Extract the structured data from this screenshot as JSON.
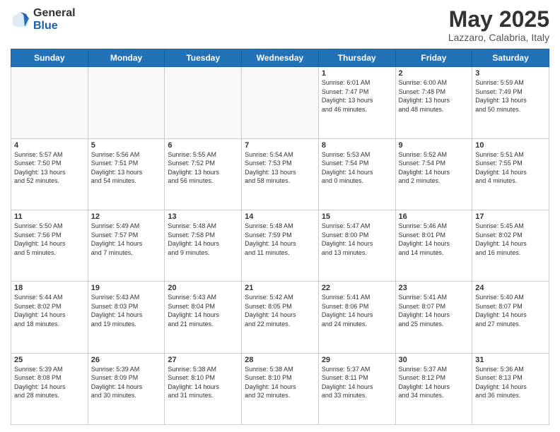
{
  "header": {
    "logo_general": "General",
    "logo_blue": "Blue",
    "month_title": "May 2025",
    "location": "Lazzaro, Calabria, Italy"
  },
  "days_of_week": [
    "Sunday",
    "Monday",
    "Tuesday",
    "Wednesday",
    "Thursday",
    "Friday",
    "Saturday"
  ],
  "weeks": [
    [
      {
        "day": "",
        "info": ""
      },
      {
        "day": "",
        "info": ""
      },
      {
        "day": "",
        "info": ""
      },
      {
        "day": "",
        "info": ""
      },
      {
        "day": "1",
        "info": "Sunrise: 6:01 AM\nSunset: 7:47 PM\nDaylight: 13 hours\nand 46 minutes."
      },
      {
        "day": "2",
        "info": "Sunrise: 6:00 AM\nSunset: 7:48 PM\nDaylight: 13 hours\nand 48 minutes."
      },
      {
        "day": "3",
        "info": "Sunrise: 5:59 AM\nSunset: 7:49 PM\nDaylight: 13 hours\nand 50 minutes."
      }
    ],
    [
      {
        "day": "4",
        "info": "Sunrise: 5:57 AM\nSunset: 7:50 PM\nDaylight: 13 hours\nand 52 minutes."
      },
      {
        "day": "5",
        "info": "Sunrise: 5:56 AM\nSunset: 7:51 PM\nDaylight: 13 hours\nand 54 minutes."
      },
      {
        "day": "6",
        "info": "Sunrise: 5:55 AM\nSunset: 7:52 PM\nDaylight: 13 hours\nand 56 minutes."
      },
      {
        "day": "7",
        "info": "Sunrise: 5:54 AM\nSunset: 7:53 PM\nDaylight: 13 hours\nand 58 minutes."
      },
      {
        "day": "8",
        "info": "Sunrise: 5:53 AM\nSunset: 7:54 PM\nDaylight: 14 hours\nand 0 minutes."
      },
      {
        "day": "9",
        "info": "Sunrise: 5:52 AM\nSunset: 7:54 PM\nDaylight: 14 hours\nand 2 minutes."
      },
      {
        "day": "10",
        "info": "Sunrise: 5:51 AM\nSunset: 7:55 PM\nDaylight: 14 hours\nand 4 minutes."
      }
    ],
    [
      {
        "day": "11",
        "info": "Sunrise: 5:50 AM\nSunset: 7:56 PM\nDaylight: 14 hours\nand 5 minutes."
      },
      {
        "day": "12",
        "info": "Sunrise: 5:49 AM\nSunset: 7:57 PM\nDaylight: 14 hours\nand 7 minutes."
      },
      {
        "day": "13",
        "info": "Sunrise: 5:48 AM\nSunset: 7:58 PM\nDaylight: 14 hours\nand 9 minutes."
      },
      {
        "day": "14",
        "info": "Sunrise: 5:48 AM\nSunset: 7:59 PM\nDaylight: 14 hours\nand 11 minutes."
      },
      {
        "day": "15",
        "info": "Sunrise: 5:47 AM\nSunset: 8:00 PM\nDaylight: 14 hours\nand 13 minutes."
      },
      {
        "day": "16",
        "info": "Sunrise: 5:46 AM\nSunset: 8:01 PM\nDaylight: 14 hours\nand 14 minutes."
      },
      {
        "day": "17",
        "info": "Sunrise: 5:45 AM\nSunset: 8:02 PM\nDaylight: 14 hours\nand 16 minutes."
      }
    ],
    [
      {
        "day": "18",
        "info": "Sunrise: 5:44 AM\nSunset: 8:02 PM\nDaylight: 14 hours\nand 18 minutes."
      },
      {
        "day": "19",
        "info": "Sunrise: 5:43 AM\nSunset: 8:03 PM\nDaylight: 14 hours\nand 19 minutes."
      },
      {
        "day": "20",
        "info": "Sunrise: 5:43 AM\nSunset: 8:04 PM\nDaylight: 14 hours\nand 21 minutes."
      },
      {
        "day": "21",
        "info": "Sunrise: 5:42 AM\nSunset: 8:05 PM\nDaylight: 14 hours\nand 22 minutes."
      },
      {
        "day": "22",
        "info": "Sunrise: 5:41 AM\nSunset: 8:06 PM\nDaylight: 14 hours\nand 24 minutes."
      },
      {
        "day": "23",
        "info": "Sunrise: 5:41 AM\nSunset: 8:07 PM\nDaylight: 14 hours\nand 25 minutes."
      },
      {
        "day": "24",
        "info": "Sunrise: 5:40 AM\nSunset: 8:07 PM\nDaylight: 14 hours\nand 27 minutes."
      }
    ],
    [
      {
        "day": "25",
        "info": "Sunrise: 5:39 AM\nSunset: 8:08 PM\nDaylight: 14 hours\nand 28 minutes."
      },
      {
        "day": "26",
        "info": "Sunrise: 5:39 AM\nSunset: 8:09 PM\nDaylight: 14 hours\nand 30 minutes."
      },
      {
        "day": "27",
        "info": "Sunrise: 5:38 AM\nSunset: 8:10 PM\nDaylight: 14 hours\nand 31 minutes."
      },
      {
        "day": "28",
        "info": "Sunrise: 5:38 AM\nSunset: 8:10 PM\nDaylight: 14 hours\nand 32 minutes."
      },
      {
        "day": "29",
        "info": "Sunrise: 5:37 AM\nSunset: 8:11 PM\nDaylight: 14 hours\nand 33 minutes."
      },
      {
        "day": "30",
        "info": "Sunrise: 5:37 AM\nSunset: 8:12 PM\nDaylight: 14 hours\nand 34 minutes."
      },
      {
        "day": "31",
        "info": "Sunrise: 5:36 AM\nSunset: 8:13 PM\nDaylight: 14 hours\nand 36 minutes."
      }
    ]
  ]
}
